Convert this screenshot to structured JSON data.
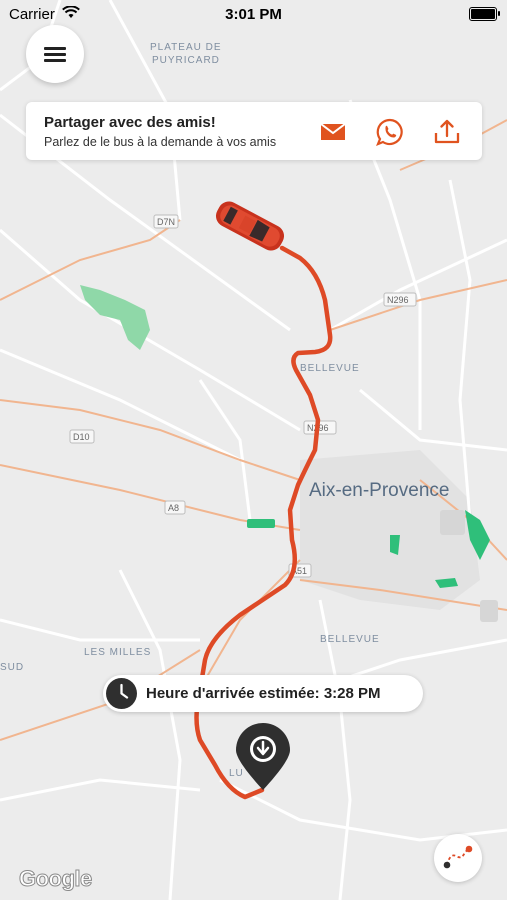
{
  "status_bar": {
    "carrier": "Carrier",
    "time": "3:01 PM"
  },
  "share_card": {
    "title": "Partager avec des amis!",
    "subtitle": "Parlez de le bus à la demande à vos amis",
    "actions": [
      "mail-icon",
      "whatsapp-icon",
      "share-icon"
    ]
  },
  "map": {
    "place_labels": {
      "plateau_line1": "PLATEAU DE",
      "plateau_line2": "PUYRICARD",
      "bellevue_north": "BELLEVUE",
      "aix": "Aix-en-Provence",
      "bellevue_south": "BELLEVUE",
      "les_milles": "LES MILLES",
      "sud": "SUD",
      "lu": "LU"
    },
    "road_labels": {
      "d7n": "D7N",
      "n296_east": "N296",
      "n296": "N296",
      "d10": "D10",
      "a8": "A8",
      "a51": "A51"
    },
    "attribution": "Google"
  },
  "eta": {
    "text": "Heure d'arrivée estimée: 3:28 PM"
  },
  "colors": {
    "route": "#de4a26",
    "accent": "#e0531f",
    "car": "#c8321d",
    "pin": "#2f2f2f",
    "green": "#2fbf7a"
  }
}
